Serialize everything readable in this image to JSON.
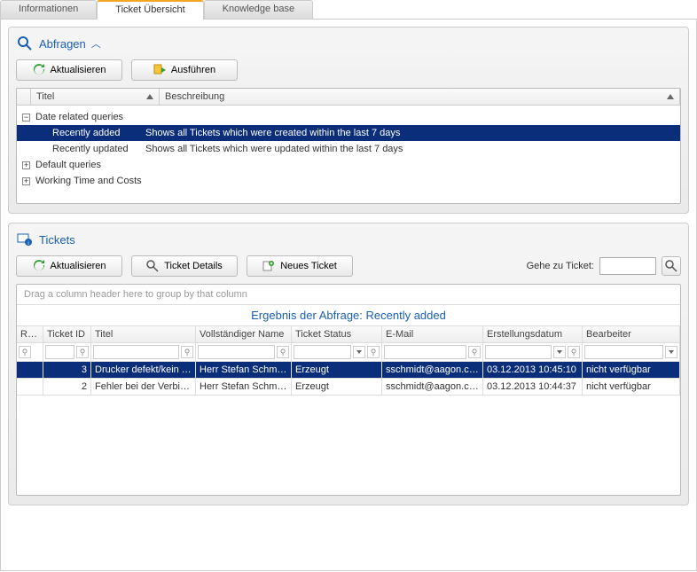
{
  "tabs": [
    {
      "label": "Informationen",
      "active": false
    },
    {
      "label": "Ticket Übersicht",
      "active": true
    },
    {
      "label": "Knowledge base",
      "active": false
    }
  ],
  "abfragen": {
    "title": "Abfragen",
    "btn_refresh": "Aktualisieren",
    "btn_run": "Ausführen",
    "col_title": "Titel",
    "col_desc": "Beschreibung",
    "groups": [
      {
        "name": "Date related queries",
        "expanded": true,
        "items": [
          {
            "title": "Recently added",
            "desc": "Shows all Tickets which were created within the last 7 days",
            "selected": true
          },
          {
            "title": "Recently updated",
            "desc": "Shows all Tickets which were updated within the last 7 days",
            "selected": false
          }
        ]
      },
      {
        "name": "Default queries",
        "expanded": false,
        "items": []
      },
      {
        "name": "Working Time and Costs",
        "expanded": false,
        "items": []
      }
    ]
  },
  "tickets": {
    "title": "Tickets",
    "btn_refresh": "Aktualisieren",
    "btn_details": "Ticket Details",
    "btn_new": "Neues Ticket",
    "goto_label": "Gehe zu Ticket:",
    "goto_value": "",
    "groupbar": "Drag a column header here to group by that column",
    "result_prefix": "Ergebnis der Abfrage: ",
    "result_query": "Recently added",
    "columns": {
      "read": "Read",
      "id": "Ticket ID",
      "title": "Titel",
      "name": "Vollständiger Name",
      "status": "Ticket Status",
      "email": "E-Mail",
      "date": "Erstellungsdatum",
      "bearbeiter": "Bearbeiter"
    },
    "rows": [
      {
        "id": "3",
        "title": "Drucker defekt/kein To",
        "name": "Herr Stefan Schmidt",
        "status": "Erzeugt",
        "email": "sschmidt@aagon.com",
        "date": "03.12.2013 10:45:10",
        "bearbeiter": "nicht verfügbar",
        "selected": true
      },
      {
        "id": "2",
        "title": "Fehler bei der Verbindu",
        "name": "Herr Stefan Schmidt",
        "status": "Erzeugt",
        "email": "sschmidt@aagon.com",
        "date": "03.12.2013 10:44:37",
        "bearbeiter": "nicht verfügbar",
        "selected": false
      }
    ]
  }
}
